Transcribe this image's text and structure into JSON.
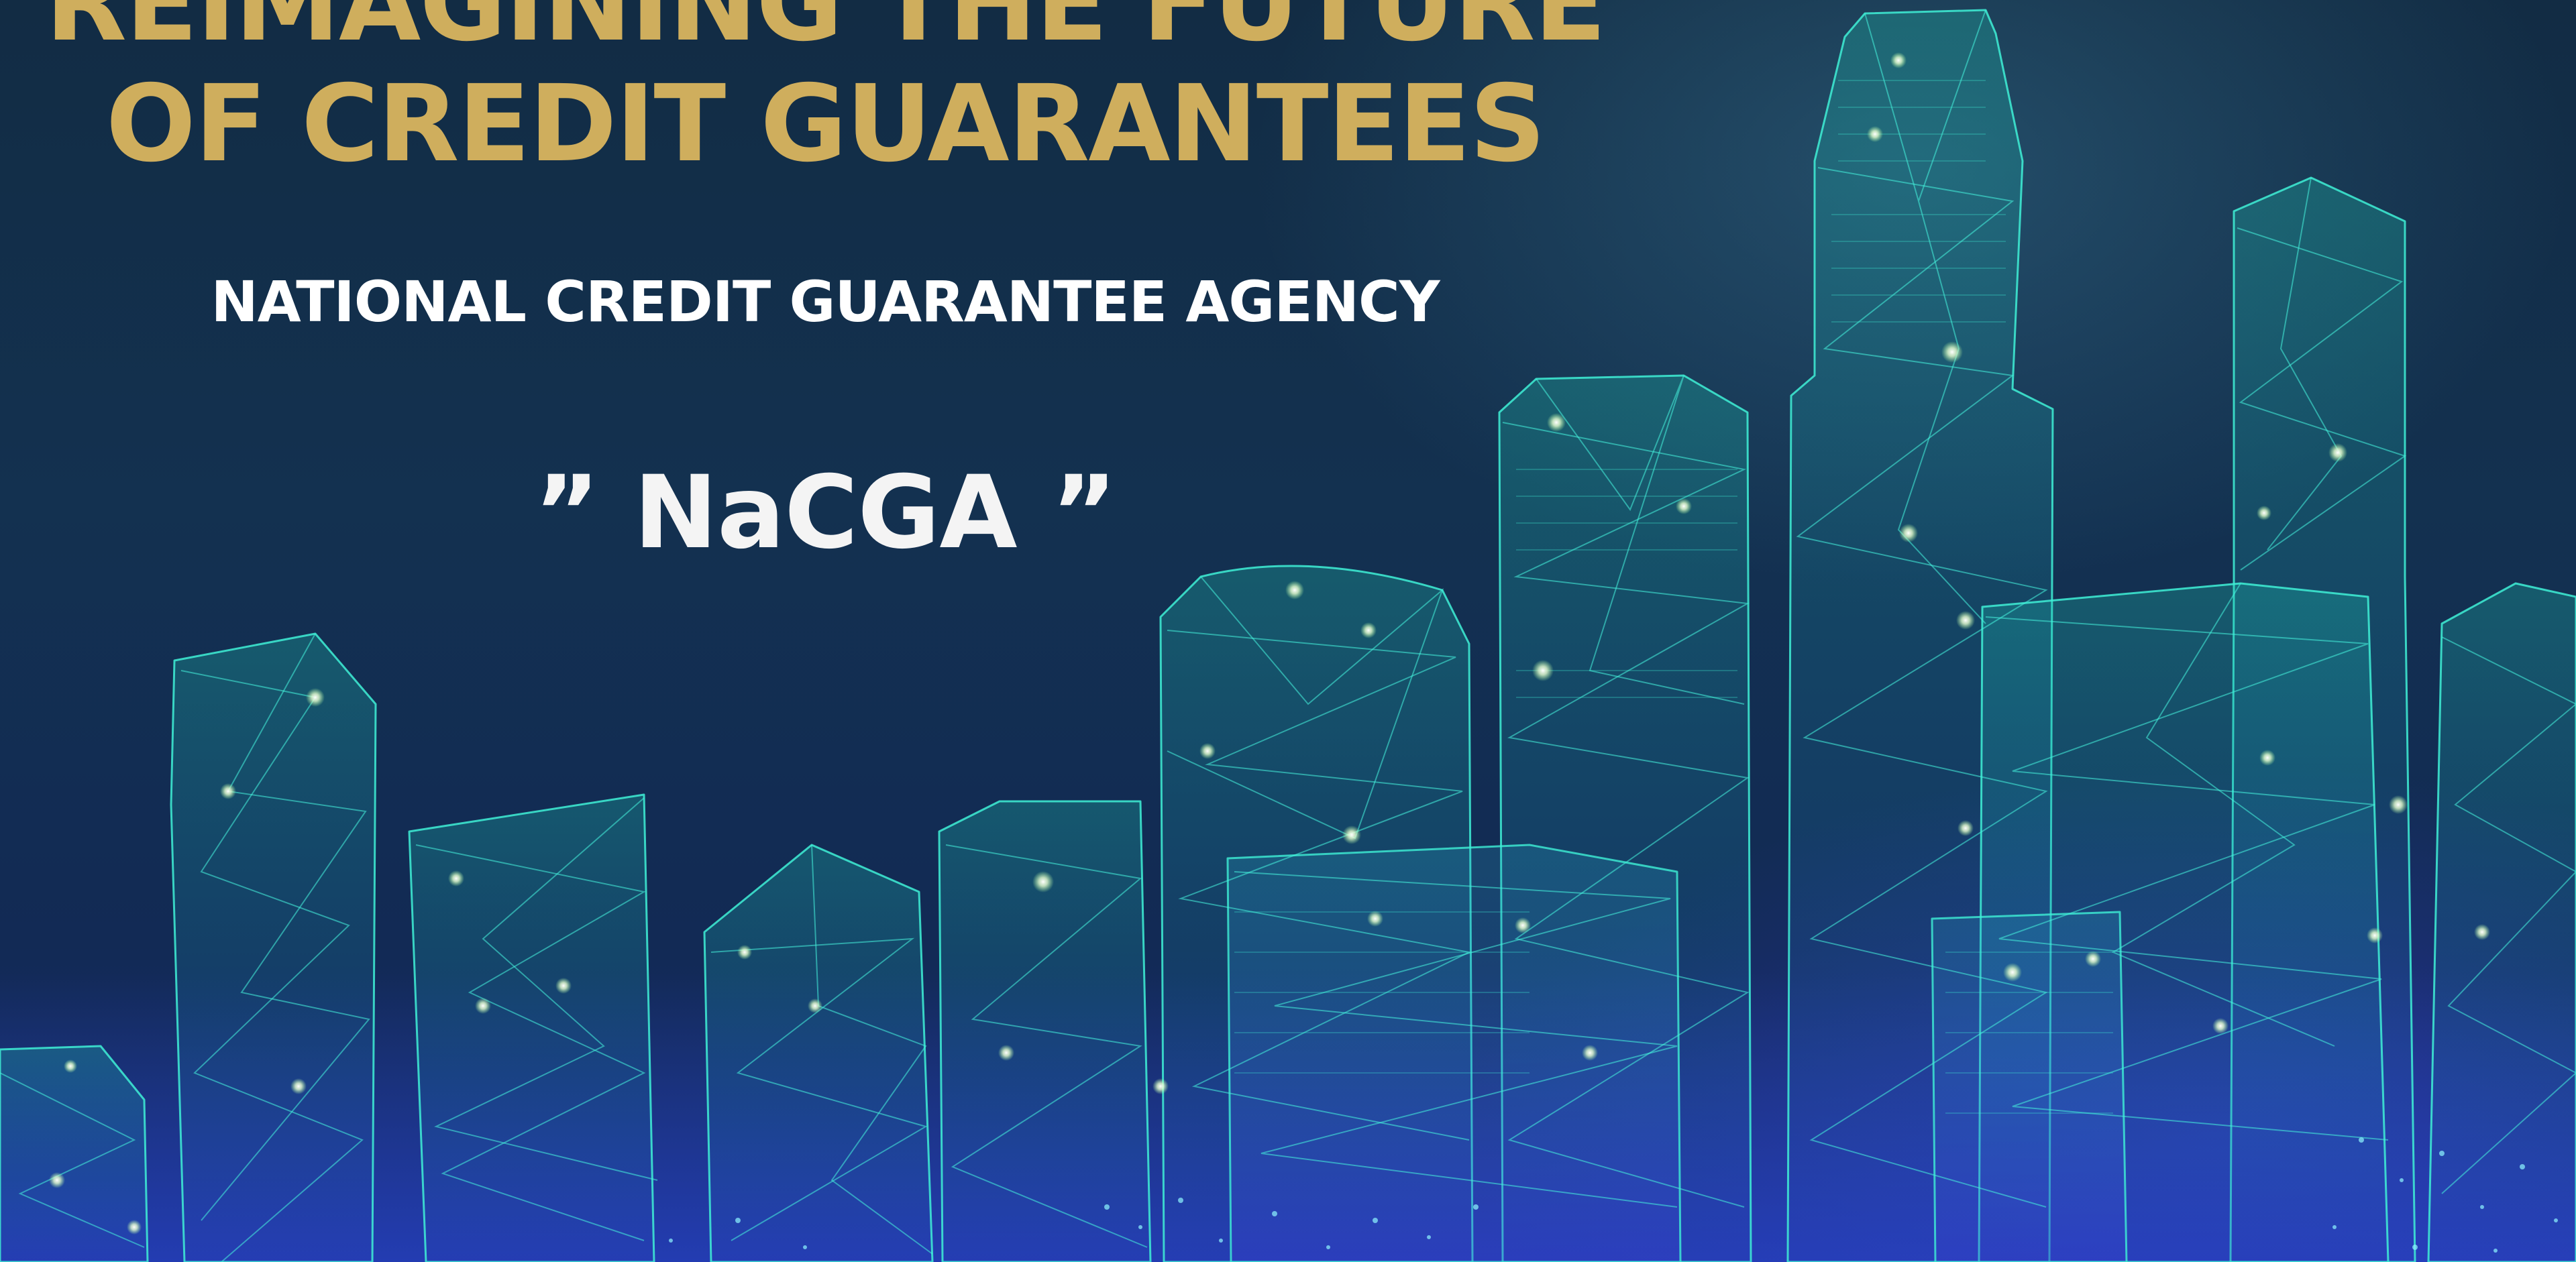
{
  "headline": {
    "line1": "REIMAGINING THE FUTURE",
    "line2": "OF CREDIT GUARANTEES"
  },
  "agency_name": "NATIONAL CREDIT GUARANTEE AGENCY",
  "acronym": "” NaCGA ”",
  "colors": {
    "headline": "#cfae5d",
    "agency": "#ffffff",
    "background_top": "#122c44",
    "background_bottom": "#1a2a7a",
    "wireframe": "#3ff0d6",
    "node": "#f2f7c8"
  },
  "illustration": "wireframe-city-skyline"
}
